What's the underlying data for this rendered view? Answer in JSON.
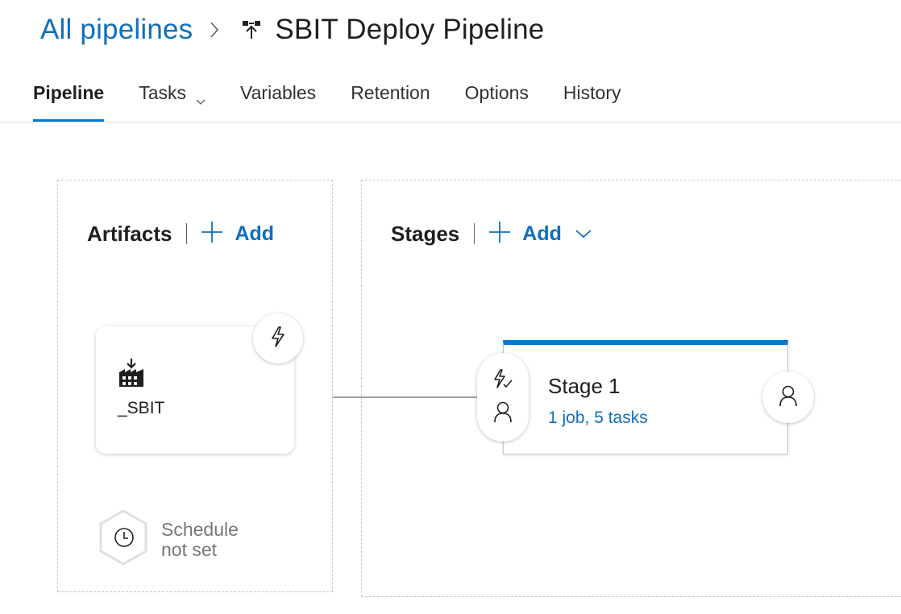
{
  "breadcrumb": {
    "parent": "All pipelines",
    "title": "SBIT Deploy Pipeline",
    "separator_icon": "chevron-right-icon",
    "pipeline_icon": "release-pipeline-icon"
  },
  "tabs": [
    {
      "label": "Pipeline",
      "active": true
    },
    {
      "label": "Tasks",
      "has_dropdown": true
    },
    {
      "label": "Variables"
    },
    {
      "label": "Retention"
    },
    {
      "label": "Options"
    },
    {
      "label": "History"
    }
  ],
  "artifacts": {
    "title": "Artifacts",
    "add_label": "Add",
    "items": [
      {
        "name": "_SBIT",
        "icon": "build-artifact-icon",
        "trigger_icon": "lightning-icon"
      }
    ],
    "schedule": {
      "line1": "Schedule",
      "line2": "not set",
      "icon": "clock-icon"
    }
  },
  "stages": {
    "title": "Stages",
    "add_label": "Add",
    "items": [
      {
        "name": "Stage 1",
        "summary": "1 job, 5 tasks"
      }
    ]
  },
  "colors": {
    "accent": "#0078d4",
    "link": "#106ebe",
    "text": "#201f1e",
    "muted": "#797775"
  }
}
